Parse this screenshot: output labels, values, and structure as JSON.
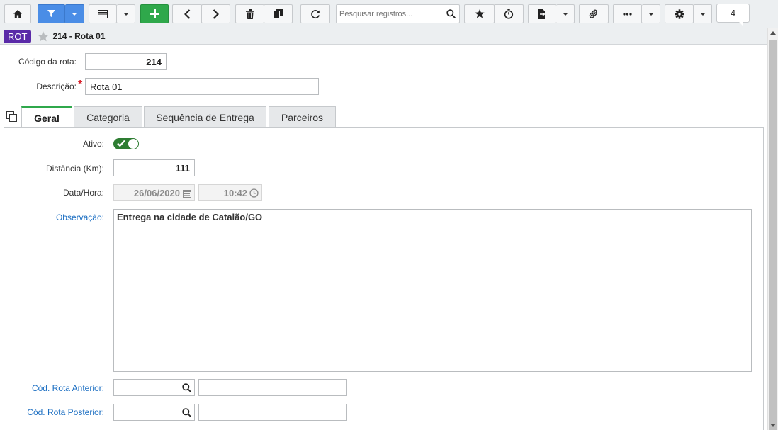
{
  "toolbar": {
    "search_placeholder": "Pesquisar registros...",
    "record_count": "4"
  },
  "titlebar": {
    "badge": "ROT",
    "title": "214 - Rota 01"
  },
  "form": {
    "codigo_label": "Código da rota:",
    "codigo_value": "214",
    "descricao_label": "Descrição:",
    "descricao_value": "Rota 01"
  },
  "tabs": [
    {
      "label": "Geral",
      "active": true
    },
    {
      "label": "Categoria"
    },
    {
      "label": "Sequência de Entrega"
    },
    {
      "label": "Parceiros"
    }
  ],
  "geral": {
    "ativo_label": "Ativo:",
    "ativo_value": true,
    "distancia_label": "Distância (Km):",
    "distancia_value": "111",
    "datahora_label": "Data/Hora:",
    "data_value": "26/06/2020",
    "hora_value": "10:42",
    "observacao_label": "Observação:",
    "observacao_value": "Entrega na cidade de Catalão/GO",
    "rota_anterior_label": "Cód. Rota Anterior:",
    "rota_posterior_label": "Cód. Rota Posterior:"
  },
  "colors": {
    "accent_blue": "#4a8de6",
    "add_green": "#2fa84b",
    "badge_purple": "#5a2aa8",
    "toggle_green": "#2e7d32",
    "link_blue": "#1b6ec2"
  }
}
